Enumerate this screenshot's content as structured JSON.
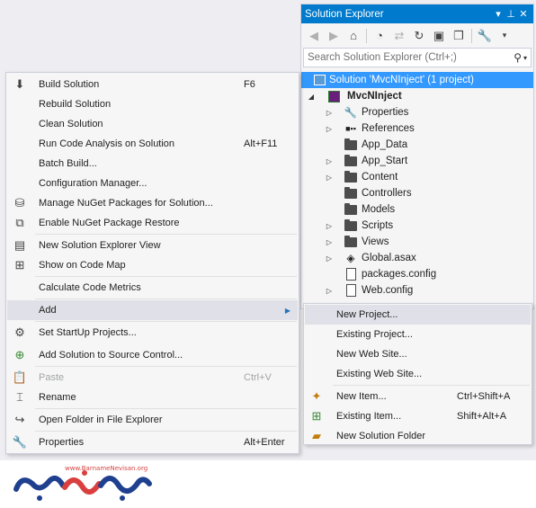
{
  "solution_explorer": {
    "title": "Solution Explorer",
    "search_placeholder": "Search Solution Explorer (Ctrl+;)",
    "tree": [
      {
        "label": "Solution 'MvcNInject' (1 project)",
        "icon": "solution-icon",
        "selected": true
      },
      {
        "label": "MvcNInject",
        "icon": "csharp-web-project-icon",
        "bold": true
      },
      {
        "label": "Properties",
        "icon": "wrench-icon"
      },
      {
        "label": "References",
        "icon": "references-icon"
      },
      {
        "label": "App_Data",
        "icon": "folder-icon"
      },
      {
        "label": "App_Start",
        "icon": "folder-icon"
      },
      {
        "label": "Content",
        "icon": "folder-icon"
      },
      {
        "label": "Controllers",
        "icon": "folder-icon"
      },
      {
        "label": "Models",
        "icon": "folder-icon"
      },
      {
        "label": "Scripts",
        "icon": "folder-icon"
      },
      {
        "label": "Views",
        "icon": "folder-icon"
      },
      {
        "label": "Global.asax",
        "icon": "global-asax-icon"
      },
      {
        "label": "packages.config",
        "icon": "config-file-icon"
      },
      {
        "label": "Web.config",
        "icon": "config-file-icon"
      }
    ]
  },
  "context_menu": {
    "items": [
      {
        "label": "Build Solution",
        "shortcut": "F6",
        "icon": "build-icon"
      },
      {
        "label": "Rebuild Solution",
        "shortcut": ""
      },
      {
        "label": "Clean Solution",
        "shortcut": ""
      },
      {
        "label": "Run Code Analysis on Solution",
        "shortcut": "Alt+F11"
      },
      {
        "label": "Batch Build...",
        "shortcut": ""
      },
      {
        "label": "Configuration Manager...",
        "shortcut": ""
      },
      {
        "label": "Manage NuGet Packages for Solution...",
        "shortcut": "",
        "icon": "nuget-icon"
      },
      {
        "label": "Enable NuGet Package Restore",
        "shortcut": "",
        "icon": "nuget-restore-icon"
      },
      {
        "label": "New Solution Explorer View",
        "shortcut": "",
        "icon": "new-view-icon"
      },
      {
        "label": "Show on Code Map",
        "shortcut": "",
        "icon": "code-map-icon"
      },
      {
        "label": "Calculate Code Metrics",
        "shortcut": ""
      },
      {
        "label": "Add",
        "shortcut": "",
        "submenu": true
      },
      {
        "label": "Set StartUp Projects...",
        "shortcut": "",
        "icon": "gear-icon"
      },
      {
        "label": "Add Solution to Source Control...",
        "shortcut": "",
        "icon": "source-control-icon"
      },
      {
        "label": "Paste",
        "shortcut": "Ctrl+V",
        "icon": "paste-icon",
        "disabled": true
      },
      {
        "label": "Rename",
        "shortcut": "",
        "icon": "rename-icon"
      },
      {
        "label": "Open Folder in File Explorer",
        "shortcut": "",
        "icon": "open-folder-icon"
      },
      {
        "label": "Properties",
        "shortcut": "Alt+Enter",
        "icon": "wrench-icon"
      }
    ]
  },
  "add_submenu": {
    "items": [
      {
        "label": "New Project...",
        "shortcut": ""
      },
      {
        "label": "Existing Project...",
        "shortcut": ""
      },
      {
        "label": "New Web Site...",
        "shortcut": ""
      },
      {
        "label": "Existing Web Site...",
        "shortcut": ""
      },
      {
        "label": "New Item...",
        "shortcut": "Ctrl+Shift+A",
        "icon": "new-item-icon"
      },
      {
        "label": "Existing Item...",
        "shortcut": "Shift+Alt+A",
        "icon": "existing-item-icon"
      },
      {
        "label": "New Solution Folder",
        "shortcut": "",
        "icon": "new-folder-icon"
      }
    ]
  },
  "watermark": {
    "url": "www.BarnameNevisan.org",
    "logo_text": "برنامه نویسان"
  },
  "colors": {
    "accent": "#007acc",
    "selection": "#3399ff",
    "logo_red": "#d93f3f",
    "logo_blue": "#1f3f8f"
  }
}
